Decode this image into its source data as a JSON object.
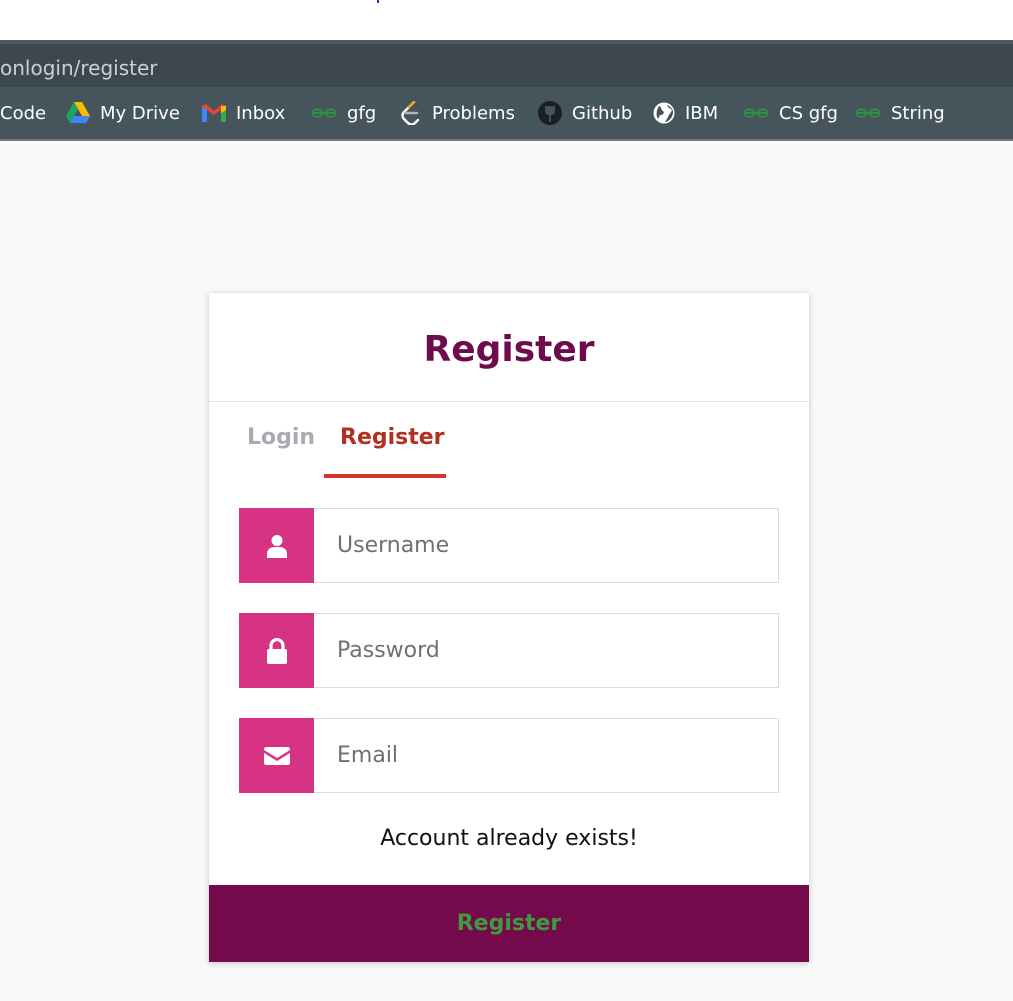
{
  "browser": {
    "url_text": "onlogin/register",
    "bookmarks": [
      {
        "label": "Code",
        "icon": "code-icon"
      },
      {
        "label": "My Drive",
        "icon": "google-drive-icon"
      },
      {
        "label": "Inbox",
        "icon": "gmail-icon"
      },
      {
        "label": "gfg",
        "icon": "gfg-icon"
      },
      {
        "label": "Problems",
        "icon": "leetcode-icon"
      },
      {
        "label": "Github",
        "icon": "github-icon"
      },
      {
        "label": "IBM",
        "icon": "globe-icon"
      },
      {
        "label": "CS gfg",
        "icon": "gfg-icon"
      },
      {
        "label": "String",
        "icon": "gfg-icon"
      }
    ]
  },
  "card": {
    "title": "Register",
    "tabs": [
      {
        "label": "Login",
        "active": false
      },
      {
        "label": "Register",
        "active": true
      }
    ],
    "fields": {
      "username": {
        "placeholder": "Username",
        "value": "",
        "icon": "user-icon"
      },
      "password": {
        "placeholder": "Password",
        "value": "",
        "icon": "lock-icon"
      },
      "email": {
        "placeholder": "Email",
        "value": "",
        "icon": "envelope-icon"
      }
    },
    "message": "Account already exists!",
    "submit_label": "Register"
  },
  "colors": {
    "accent": "#d63385",
    "primary": "#740a4b",
    "title": "#6e0b4a",
    "active_tab": "#b22f22",
    "tab_underline": "#d9322a",
    "submit_text": "#3f9a3e"
  }
}
